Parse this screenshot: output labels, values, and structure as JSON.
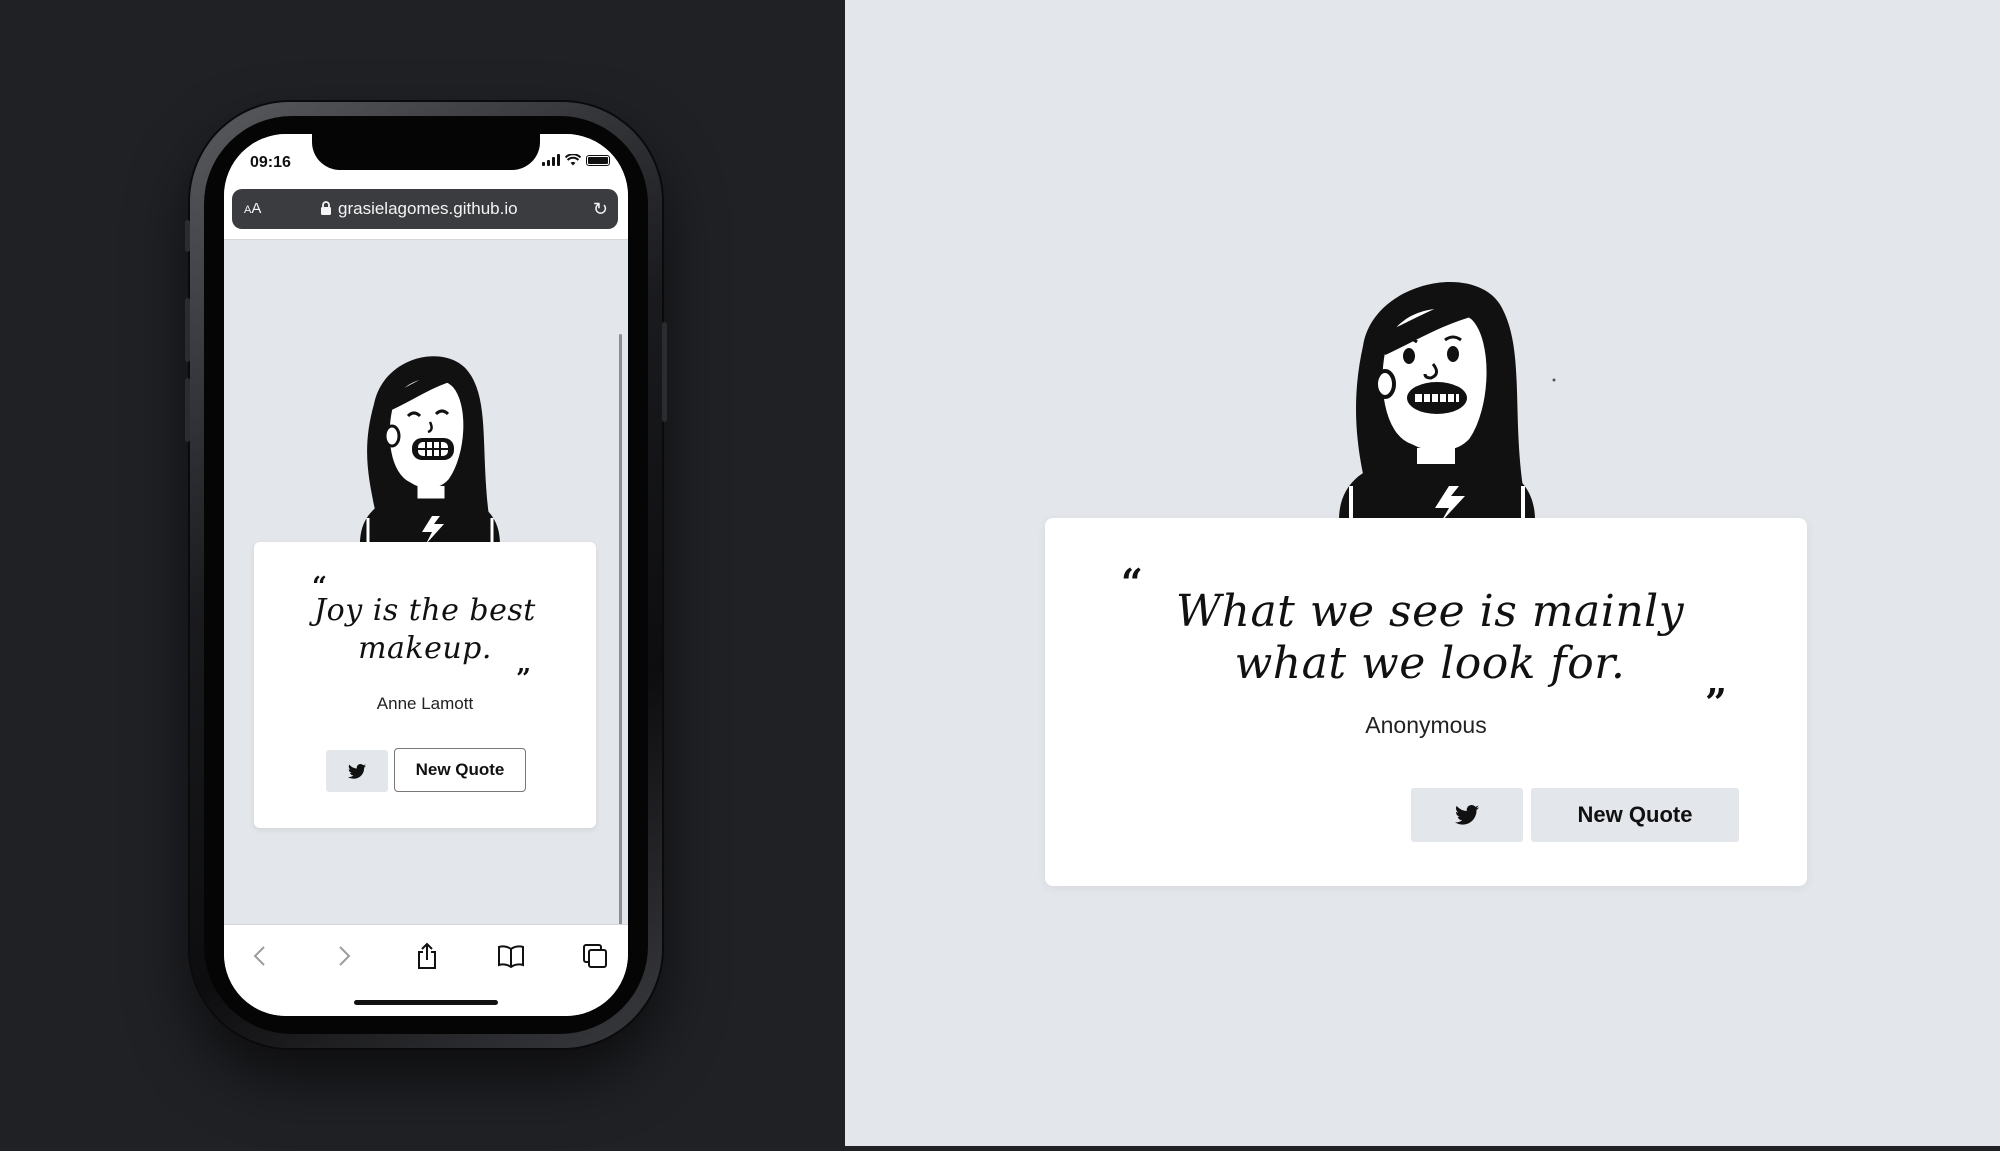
{
  "mobile": {
    "status_time": "09:16",
    "url_aa": "AA",
    "url": "grasielagomes.github.io",
    "quote": "Joy is the best makeup.",
    "author": "Anne Lamott",
    "new_quote_label": "New Quote",
    "toolbar_icons": [
      "back-icon",
      "forward-icon",
      "share-icon",
      "bookmarks-icon",
      "tabs-icon"
    ]
  },
  "desktop": {
    "quote": "What we see is mainly what we look for.",
    "author": "Anonymous",
    "new_quote_label": "New Quote"
  },
  "colors": {
    "page_bg": "#e3e6ea",
    "card_bg": "#ffffff",
    "outer_bg": "#202125",
    "text": "#111111"
  }
}
